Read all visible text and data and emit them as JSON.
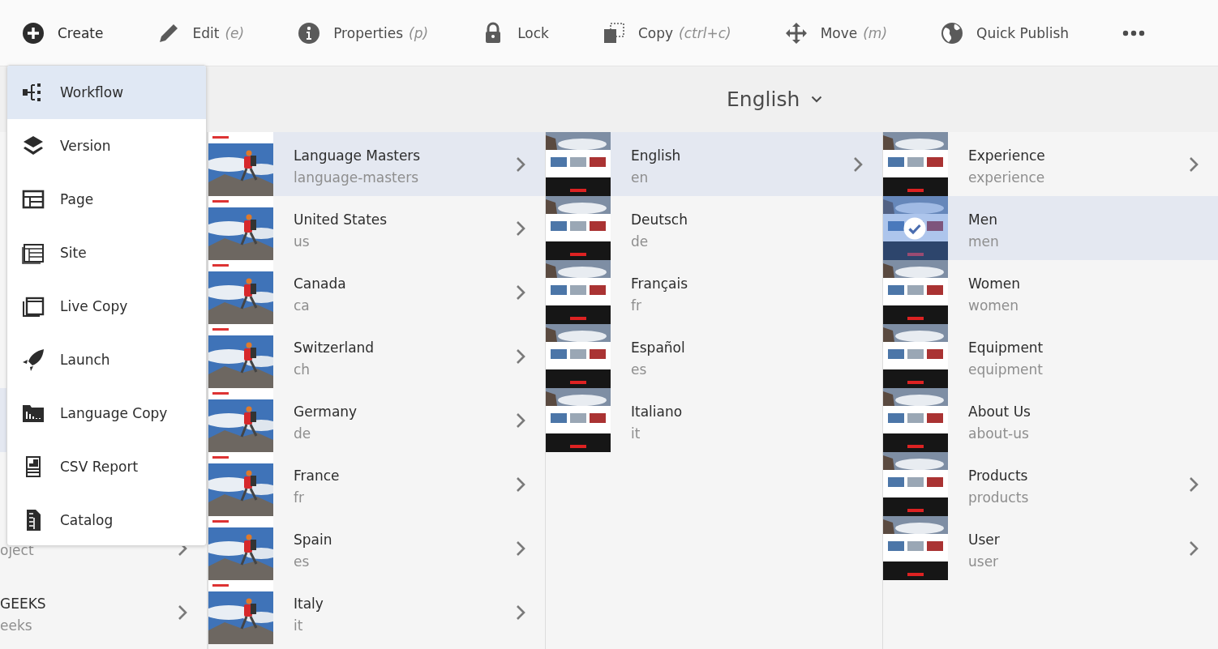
{
  "toolbar": {
    "items": [
      {
        "kind": "create",
        "label": "Create"
      },
      {
        "kind": "edit",
        "label": "Edit",
        "shortcut": "(e)"
      },
      {
        "kind": "properties",
        "label": "Properties",
        "shortcut": "(p)"
      },
      {
        "kind": "lock",
        "label": "Lock"
      },
      {
        "kind": "copy",
        "label": "Copy",
        "shortcut": "(ctrl+c)"
      },
      {
        "kind": "move",
        "label": "Move",
        "shortcut": "(m)"
      },
      {
        "kind": "publish",
        "label": "Quick Publish"
      },
      {
        "kind": "more"
      }
    ]
  },
  "create_menu": {
    "items": [
      {
        "kind": "workflow",
        "label": "Workflow",
        "selected": true
      },
      {
        "kind": "version",
        "label": "Version",
        "selected": false
      },
      {
        "kind": "page",
        "label": "Page",
        "selected": false
      },
      {
        "kind": "site",
        "label": "Site",
        "selected": false
      },
      {
        "kind": "livecopy",
        "label": "Live Copy",
        "selected": false
      },
      {
        "kind": "launch",
        "label": "Launch",
        "selected": false
      },
      {
        "kind": "languagecopy",
        "label": "Language Copy",
        "selected": false
      },
      {
        "kind": "csvreport",
        "label": "CSV Report",
        "selected": false
      },
      {
        "kind": "catalog",
        "label": "Catalog",
        "selected": false
      }
    ]
  },
  "location": {
    "label": "English"
  },
  "columns": [
    {
      "rows": [
        {
          "selected": false
        },
        {
          "selected": false
        },
        {
          "selected": false
        },
        {
          "selected": false
        },
        {
          "selected": true
        },
        {
          "selected": false
        },
        {
          "subtitle": "oject",
          "has_children": true,
          "selected": false
        },
        {
          "title": "GEEKS",
          "subtitle": "eeks",
          "has_children": true,
          "selected": false
        }
      ]
    },
    {
      "rows": [
        {
          "title": "Language Masters",
          "subtitle": "language-masters",
          "has_children": true,
          "selected": true
        },
        {
          "title": "United States",
          "subtitle": "us",
          "has_children": true,
          "selected": false
        },
        {
          "title": "Canada",
          "subtitle": "ca",
          "has_children": true,
          "selected": false
        },
        {
          "title": "Switzerland",
          "subtitle": "ch",
          "has_children": true,
          "selected": false
        },
        {
          "title": "Germany",
          "subtitle": "de",
          "has_children": true,
          "selected": false
        },
        {
          "title": "France",
          "subtitle": "fr",
          "has_children": true,
          "selected": false
        },
        {
          "title": "Spain",
          "subtitle": "es",
          "has_children": true,
          "selected": false
        },
        {
          "title": "Italy",
          "subtitle": "it",
          "has_children": true,
          "selected": false
        }
      ]
    },
    {
      "rows": [
        {
          "title": "English",
          "subtitle": "en",
          "has_children": true,
          "selected": true
        },
        {
          "title": "Deutsch",
          "subtitle": "de",
          "has_children": false,
          "selected": false
        },
        {
          "title": "Français",
          "subtitle": "fr",
          "has_children": false,
          "selected": false
        },
        {
          "title": "Español",
          "subtitle": "es",
          "has_children": false,
          "selected": false
        },
        {
          "title": "Italiano",
          "subtitle": "it",
          "has_children": false,
          "selected": false
        }
      ]
    },
    {
      "rows": [
        {
          "title": "Experience",
          "subtitle": "experience",
          "has_children": true,
          "selected": false,
          "checked": false
        },
        {
          "title": "Men",
          "subtitle": "men",
          "has_children": false,
          "selected": true,
          "checked": true
        },
        {
          "title": "Women",
          "subtitle": "women",
          "has_children": false,
          "selected": false,
          "checked": false
        },
        {
          "title": "Equipment",
          "subtitle": "equipment",
          "has_children": false,
          "selected": false,
          "checked": false
        },
        {
          "title": "About Us",
          "subtitle": "about-us",
          "has_children": false,
          "selected": false,
          "checked": false
        },
        {
          "title": "Products",
          "subtitle": "products",
          "has_children": true,
          "selected": false,
          "checked": false
        },
        {
          "title": "User",
          "subtitle": "user",
          "has_children": true,
          "selected": false,
          "checked": false
        }
      ]
    }
  ]
}
